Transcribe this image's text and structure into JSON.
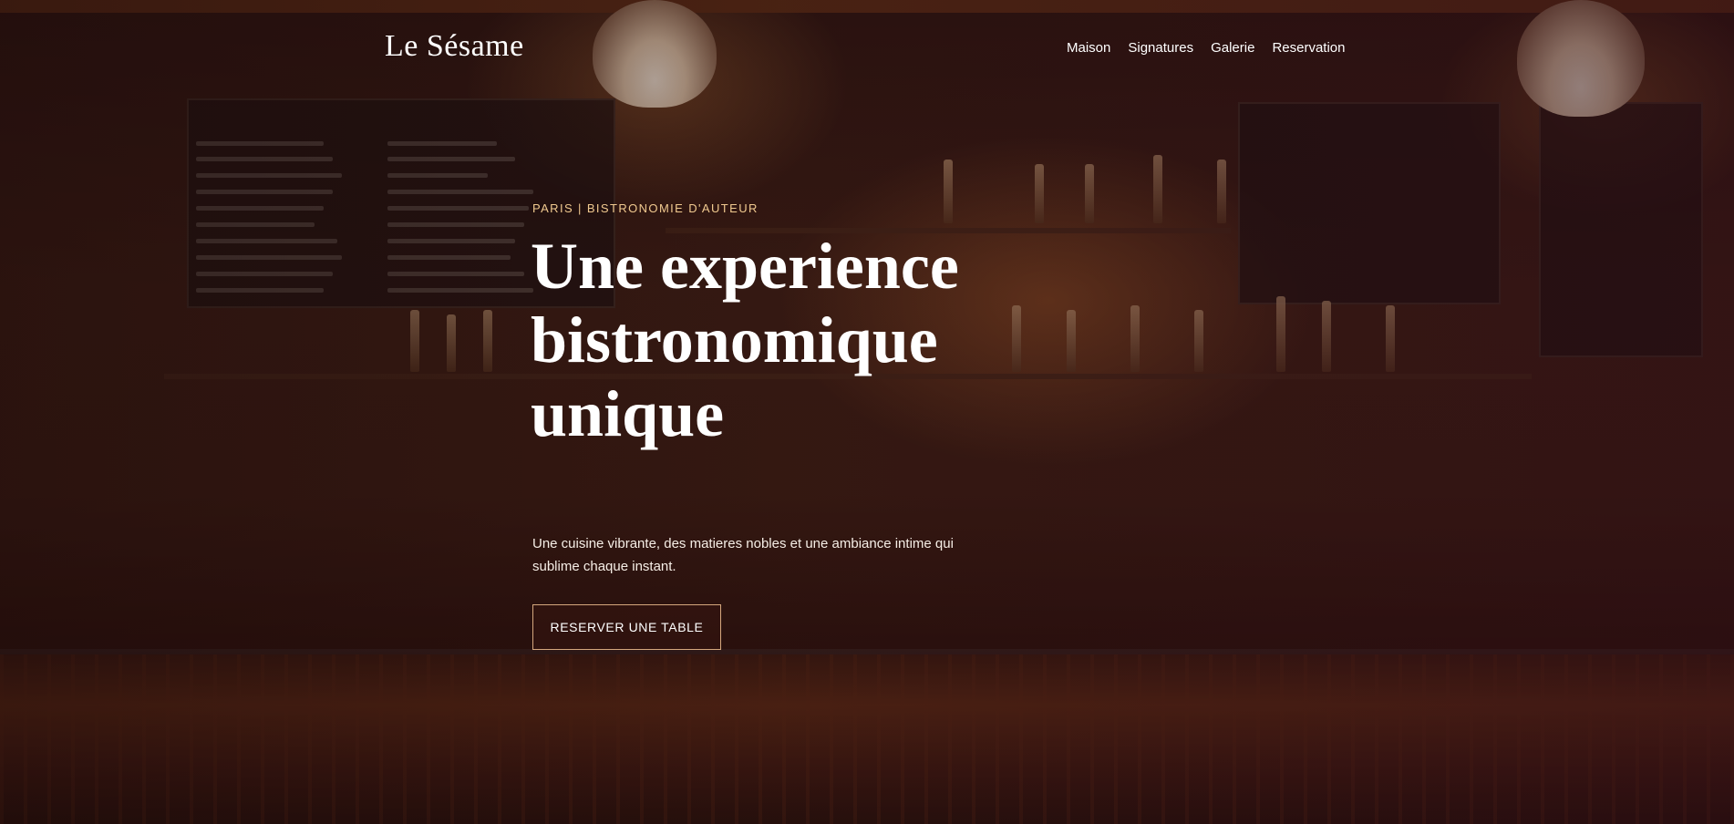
{
  "header": {
    "logo": "Le Sésame",
    "nav": [
      {
        "label": "Maison"
      },
      {
        "label": "Signatures"
      },
      {
        "label": "Galerie"
      },
      {
        "label": "Reservation"
      }
    ]
  },
  "hero": {
    "eyebrow": "PARIS | BISTRONOMIE D'AUTEUR",
    "headline": "Une experience bistronomique unique",
    "subtitle": "Une cuisine vibrante, des matieres nobles et une ambiance intime qui sublime chaque instant.",
    "cta_label": "RESERVER UNE TABLE",
    "background": "bar-interior-photo"
  },
  "colors": {
    "accent": "#f0c98f",
    "cta_border": "#d5a77d",
    "text": "#ffffff"
  }
}
